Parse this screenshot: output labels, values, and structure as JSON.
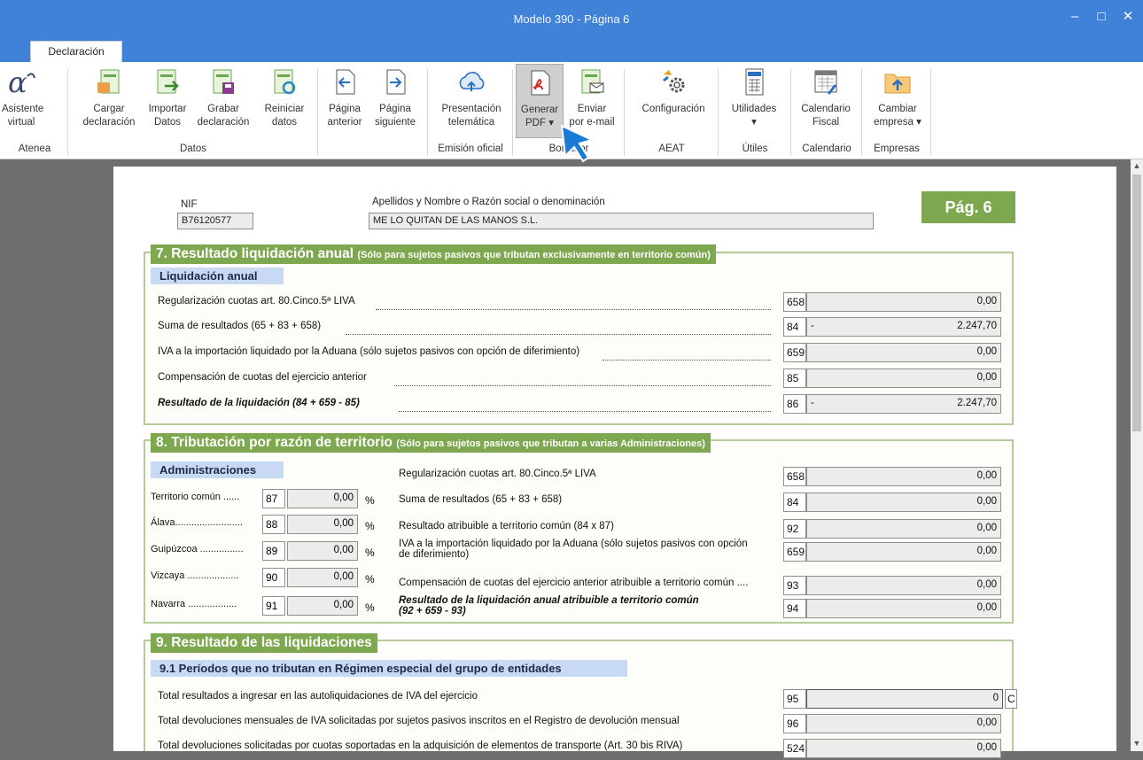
{
  "window": {
    "title": "Modelo 390 - Página 6",
    "min": "–",
    "max": "□",
    "close": "✕"
  },
  "ribbon": {
    "tab": "Declaración",
    "groups": [
      "Atenea",
      "Datos",
      "Emisión oficial",
      "Borrador",
      "AEAT",
      "Útiles",
      "Calendario",
      "Empresas"
    ],
    "buttons": [
      {
        "l1": "Asistente",
        "l2": "virtual"
      },
      {
        "l1": "Cargar",
        "l2": "declaración"
      },
      {
        "l1": "Importar",
        "l2": "Datos"
      },
      {
        "l1": "Grabar",
        "l2": "declaración"
      },
      {
        "l1": "Reiniciar",
        "l2": "datos"
      },
      {
        "l1": "Página",
        "l2": "anterior"
      },
      {
        "l1": "Página",
        "l2": "siguiente"
      },
      {
        "l1": "Presentación",
        "l2": "telemática"
      },
      {
        "l1": "Generar",
        "l2": "PDF ▾"
      },
      {
        "l1": "Enviar",
        "l2": "por e-mail"
      },
      {
        "l1": "Configuración",
        "l2": ""
      },
      {
        "l1": "Utilidades",
        "l2": "▾"
      },
      {
        "l1": "Calendario",
        "l2": "Fiscal"
      },
      {
        "l1": "Cambiar",
        "l2": "empresa ▾"
      }
    ]
  },
  "header": {
    "nif_label": "NIF",
    "nif": "B76120577",
    "name_label": "Apellidos y Nombre o Razón social o denominación",
    "name": "ME LO QUITAN DE LAS MANOS S.L.",
    "page": "Pág. 6"
  },
  "s7": {
    "title": "7. Resultado liquidación anual",
    "sub": "(Sólo para sujetos pasivos que tributan exclusivamente en territorio común)",
    "box": "Liquidación anual",
    "rows": [
      {
        "t": "Regularización cuotas art. 80.Cinco.5ª LIVA",
        "c": "658",
        "s": "",
        "v": "0,00"
      },
      {
        "t": "Suma de resultados (65 + 83 + 658)",
        "c": "84",
        "s": "-",
        "v": "2.247,70"
      },
      {
        "t": "IVA a la importación liquidado por la Aduana (sólo sujetos pasivos con opción de diferimiento)",
        "c": "659",
        "s": "",
        "v": "0,00"
      },
      {
        "t": "Compensación de cuotas del ejercicio anterior",
        "c": "85",
        "s": "",
        "v": "0,00"
      },
      {
        "t": "Resultado de la liquidación (84 + 659 - 85)",
        "c": "86",
        "s": "-",
        "v": "2.247,70"
      }
    ]
  },
  "s8": {
    "title": "8. Tributación por razón de territorio",
    "sub": "(Sólo para sujetos pasivos que tributan a varias Administraciones)",
    "box": "Administraciones",
    "admins": [
      {
        "t": "Territorio común ......",
        "c": "87",
        "v": "0,00",
        "p": "%"
      },
      {
        "t": "Álava.........................",
        "c": "88",
        "v": "0,00",
        "p": "%"
      },
      {
        "t": "Guipúzcoa ................",
        "c": "89",
        "v": "0,00",
        "p": "%"
      },
      {
        "t": "Vizcaya ...................",
        "c": "90",
        "v": "0,00",
        "p": "%"
      },
      {
        "t": "Navarra ..................",
        "c": "91",
        "v": "0,00",
        "p": "%"
      }
    ],
    "rows": [
      {
        "t": "Regularización cuotas art. 80.Cinco.5ª LIVA",
        "c": "658",
        "v": "0,00"
      },
      {
        "t": "Suma de resultados (65 + 83 + 658)",
        "c": "84",
        "v": "0,00"
      },
      {
        "t": "Resultado atribuible a territorio común (84 x 87)",
        "c": "92",
        "v": "0,00"
      },
      {
        "t": "IVA a la importación liquidado por la Aduana (sólo sujetos pasivos con opción",
        "t2": "de diferimiento)",
        "c": "659",
        "v": "0,00"
      },
      {
        "t": "Compensación de cuotas del ejercicio anterior atribuible a territorio común ....",
        "c": "93",
        "v": "0,00"
      },
      {
        "t": "Resultado de la liquidación anual atribuible a territorio común",
        "t2": "(92 + 659 - 93)",
        "c": "94",
        "v": "0,00"
      }
    ]
  },
  "s9": {
    "title": "9. Resultado de las liquidaciones",
    "box": "9.1 Períodos que no tributan en Régimen especial del grupo de entidades",
    "rows": [
      {
        "t": "Total resultados a ingresar en las autoliquidaciones de IVA del ejercicio",
        "c": "95",
        "v": "0",
        "extra": "C"
      },
      {
        "t": "Total devoluciones mensuales de IVA solicitadas por sujetos pasivos inscritos en el Registro de devolución mensual",
        "c": "96",
        "v": "0,00"
      },
      {
        "t": "Total devoluciones solicitadas por cuotas soportadas en la adquisición de elementos de transporte (Art. 30 bis RIVA)",
        "c": "524",
        "v": "0,00"
      }
    ]
  }
}
